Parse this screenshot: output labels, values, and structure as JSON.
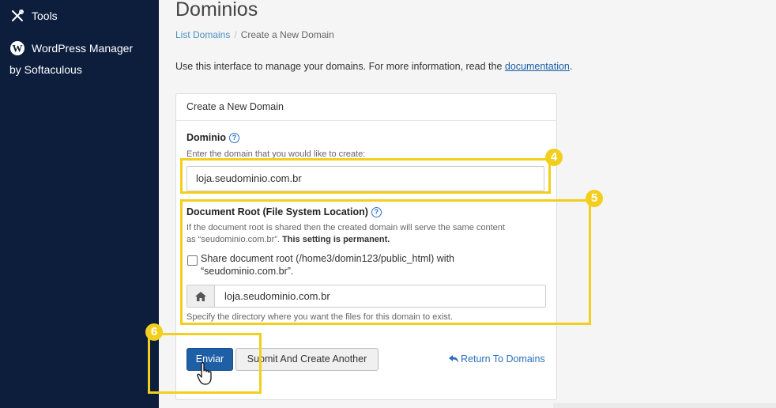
{
  "sidebar": {
    "items": [
      {
        "label": "Tools",
        "icon": "tools-icon"
      },
      {
        "label": "WordPress Manager",
        "label2": "by Softaculous",
        "icon": "wordpress-icon"
      }
    ]
  },
  "header": {
    "title": "Dominios",
    "breadcrumb": {
      "link": "List Domains",
      "separator": "/",
      "current": "Create a New Domain"
    }
  },
  "intro": {
    "text": "Use this interface to manage your domains. For more information, read the ",
    "link": "documentation",
    "suffix": "."
  },
  "panel": {
    "title": "Create a New Domain",
    "domain": {
      "label": "Dominio",
      "hint": "Enter the domain that you would like to create:",
      "value": "loja.seudominio.com.br"
    },
    "docroot": {
      "label": "Document Root (File System Location)",
      "info_line1": "If the document root is shared then the created domain will serve the same content",
      "info_line2": "as “seudominio.com.br”.",
      "info_bold": "This setting is permanent.",
      "checkbox_line1": "Share document root (/home3/domin123/public_html) with",
      "checkbox_line2": "“seudominio.com.br”.",
      "checked": false,
      "value": "loja.seudominio.com.br",
      "hint": "Specify the directory where you want the files for this domain to exist."
    },
    "buttons": {
      "submit": "Enviar",
      "submit_another": "Submit And Create Another",
      "return": "Return To Domains"
    }
  },
  "annotations": {
    "step4": "4",
    "step5": "5",
    "step6": "6",
    "color": "#f2cf1d"
  }
}
